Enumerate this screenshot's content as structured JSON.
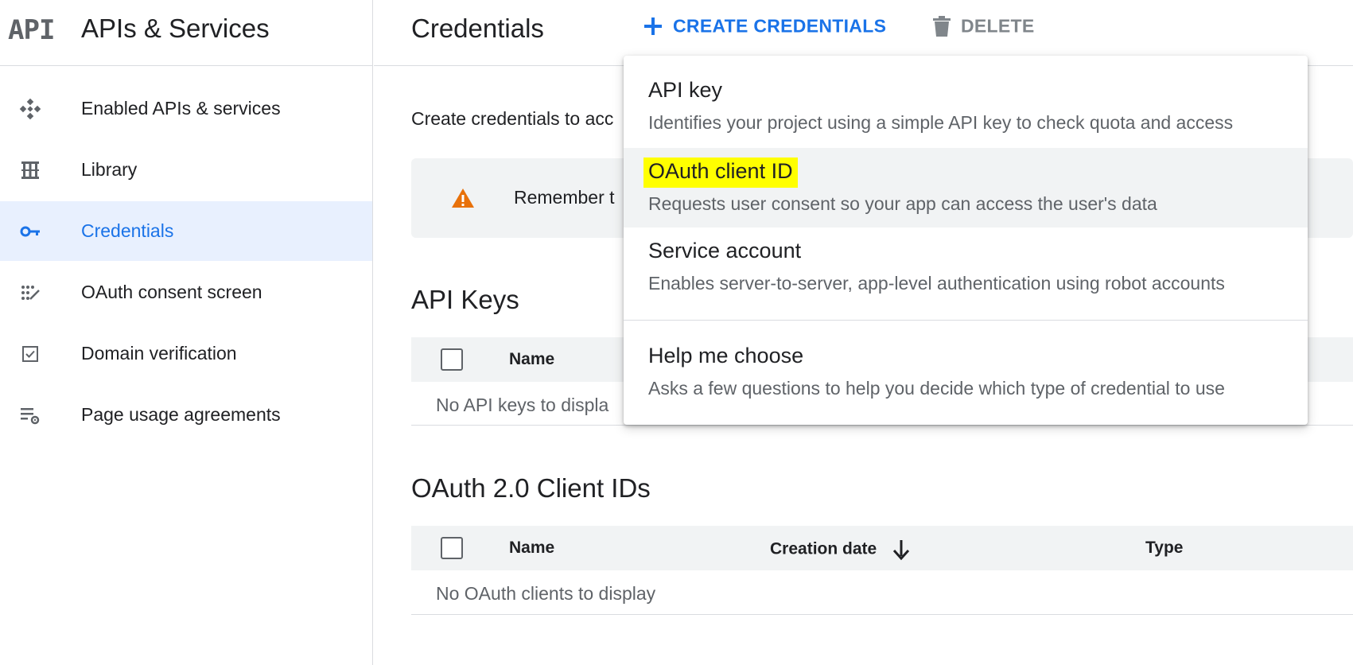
{
  "brand": {
    "logo": "API",
    "title": "APIs & Services"
  },
  "sidebar": {
    "items": [
      {
        "label": "Enabled APIs & services",
        "icon": "enabled-apis-icon"
      },
      {
        "label": "Library",
        "icon": "library-icon"
      },
      {
        "label": "Credentials",
        "icon": "key-icon",
        "active": true
      },
      {
        "label": "OAuth consent screen",
        "icon": "consent-icon"
      },
      {
        "label": "Domain verification",
        "icon": "checkbox-icon"
      },
      {
        "label": "Page usage agreements",
        "icon": "settings-list-icon"
      }
    ]
  },
  "header": {
    "title": "Credentials",
    "create_label": "CREATE CREDENTIALS",
    "delete_label": "DELETE"
  },
  "main": {
    "intro": "Create credentials to acc",
    "banner": "Remember t",
    "api_keys": {
      "title": "API Keys",
      "columns": [
        "Name"
      ],
      "empty": "No API keys to displa"
    },
    "oauth": {
      "title": "OAuth 2.0 Client IDs",
      "columns": [
        "Name",
        "Creation date",
        "Type"
      ],
      "empty": "No OAuth clients to display"
    }
  },
  "menu": {
    "items": [
      {
        "title": "API key",
        "desc": "Identifies your project using a simple API key to check quota and access"
      },
      {
        "title": "OAuth client ID",
        "desc": "Requests user consent so your app can access the user's data",
        "highlighted": true
      },
      {
        "title": "Service account",
        "desc": "Enables server-to-server, app-level authentication using robot accounts"
      },
      {
        "title": "Help me choose",
        "desc": "Asks a few questions to help you decide which type of credential to use"
      }
    ]
  },
  "colors": {
    "accent": "#1a73e8",
    "active_bg": "#e8f0fe",
    "highlight": "#ffff00",
    "warning": "#e8710a"
  }
}
